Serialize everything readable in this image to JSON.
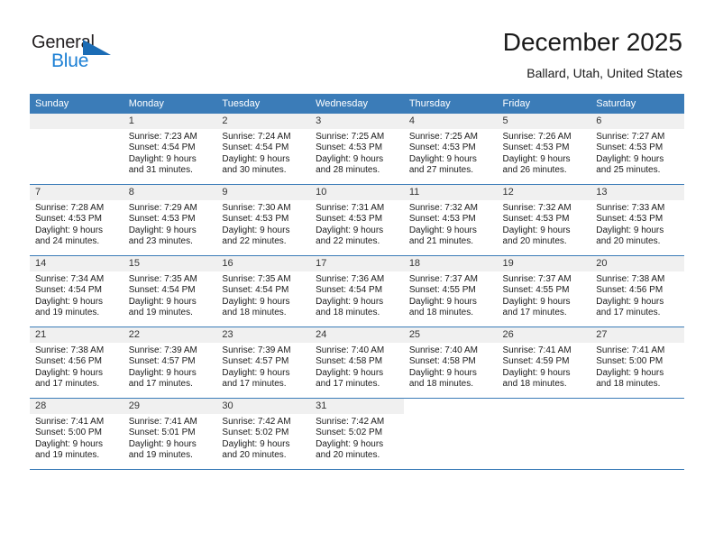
{
  "logo": {
    "word_top": "General",
    "word_bottom": "Blue",
    "triangle_color": "#1b6cb5",
    "blue_color": "#1b7fd4"
  },
  "header": {
    "month_title": "December 2025",
    "location": "Ballard, Utah, United States"
  },
  "theme": {
    "header_row_color": "#3b7cb8",
    "daynum_band_color": "#f0f0f0",
    "grid_line_color": "#3b7cb8"
  },
  "weekday_headers": [
    "Sunday",
    "Monday",
    "Tuesday",
    "Wednesday",
    "Thursday",
    "Friday",
    "Saturday"
  ],
  "weeks": [
    [
      {
        "day": "",
        "lines": []
      },
      {
        "day": "1",
        "lines": [
          "Sunrise: 7:23 AM",
          "Sunset: 4:54 PM",
          "Daylight: 9 hours",
          "and 31 minutes."
        ]
      },
      {
        "day": "2",
        "lines": [
          "Sunrise: 7:24 AM",
          "Sunset: 4:54 PM",
          "Daylight: 9 hours",
          "and 30 minutes."
        ]
      },
      {
        "day": "3",
        "lines": [
          "Sunrise: 7:25 AM",
          "Sunset: 4:53 PM",
          "Daylight: 9 hours",
          "and 28 minutes."
        ]
      },
      {
        "day": "4",
        "lines": [
          "Sunrise: 7:25 AM",
          "Sunset: 4:53 PM",
          "Daylight: 9 hours",
          "and 27 minutes."
        ]
      },
      {
        "day": "5",
        "lines": [
          "Sunrise: 7:26 AM",
          "Sunset: 4:53 PM",
          "Daylight: 9 hours",
          "and 26 minutes."
        ]
      },
      {
        "day": "6",
        "lines": [
          "Sunrise: 7:27 AM",
          "Sunset: 4:53 PM",
          "Daylight: 9 hours",
          "and 25 minutes."
        ]
      }
    ],
    [
      {
        "day": "7",
        "lines": [
          "Sunrise: 7:28 AM",
          "Sunset: 4:53 PM",
          "Daylight: 9 hours",
          "and 24 minutes."
        ]
      },
      {
        "day": "8",
        "lines": [
          "Sunrise: 7:29 AM",
          "Sunset: 4:53 PM",
          "Daylight: 9 hours",
          "and 23 minutes."
        ]
      },
      {
        "day": "9",
        "lines": [
          "Sunrise: 7:30 AM",
          "Sunset: 4:53 PM",
          "Daylight: 9 hours",
          "and 22 minutes."
        ]
      },
      {
        "day": "10",
        "lines": [
          "Sunrise: 7:31 AM",
          "Sunset: 4:53 PM",
          "Daylight: 9 hours",
          "and 22 minutes."
        ]
      },
      {
        "day": "11",
        "lines": [
          "Sunrise: 7:32 AM",
          "Sunset: 4:53 PM",
          "Daylight: 9 hours",
          "and 21 minutes."
        ]
      },
      {
        "day": "12",
        "lines": [
          "Sunrise: 7:32 AM",
          "Sunset: 4:53 PM",
          "Daylight: 9 hours",
          "and 20 minutes."
        ]
      },
      {
        "day": "13",
        "lines": [
          "Sunrise: 7:33 AM",
          "Sunset: 4:53 PM",
          "Daylight: 9 hours",
          "and 20 minutes."
        ]
      }
    ],
    [
      {
        "day": "14",
        "lines": [
          "Sunrise: 7:34 AM",
          "Sunset: 4:54 PM",
          "Daylight: 9 hours",
          "and 19 minutes."
        ]
      },
      {
        "day": "15",
        "lines": [
          "Sunrise: 7:35 AM",
          "Sunset: 4:54 PM",
          "Daylight: 9 hours",
          "and 19 minutes."
        ]
      },
      {
        "day": "16",
        "lines": [
          "Sunrise: 7:35 AM",
          "Sunset: 4:54 PM",
          "Daylight: 9 hours",
          "and 18 minutes."
        ]
      },
      {
        "day": "17",
        "lines": [
          "Sunrise: 7:36 AM",
          "Sunset: 4:54 PM",
          "Daylight: 9 hours",
          "and 18 minutes."
        ]
      },
      {
        "day": "18",
        "lines": [
          "Sunrise: 7:37 AM",
          "Sunset: 4:55 PM",
          "Daylight: 9 hours",
          "and 18 minutes."
        ]
      },
      {
        "day": "19",
        "lines": [
          "Sunrise: 7:37 AM",
          "Sunset: 4:55 PM",
          "Daylight: 9 hours",
          "and 17 minutes."
        ]
      },
      {
        "day": "20",
        "lines": [
          "Sunrise: 7:38 AM",
          "Sunset: 4:56 PM",
          "Daylight: 9 hours",
          "and 17 minutes."
        ]
      }
    ],
    [
      {
        "day": "21",
        "lines": [
          "Sunrise: 7:38 AM",
          "Sunset: 4:56 PM",
          "Daylight: 9 hours",
          "and 17 minutes."
        ]
      },
      {
        "day": "22",
        "lines": [
          "Sunrise: 7:39 AM",
          "Sunset: 4:57 PM",
          "Daylight: 9 hours",
          "and 17 minutes."
        ]
      },
      {
        "day": "23",
        "lines": [
          "Sunrise: 7:39 AM",
          "Sunset: 4:57 PM",
          "Daylight: 9 hours",
          "and 17 minutes."
        ]
      },
      {
        "day": "24",
        "lines": [
          "Sunrise: 7:40 AM",
          "Sunset: 4:58 PM",
          "Daylight: 9 hours",
          "and 17 minutes."
        ]
      },
      {
        "day": "25",
        "lines": [
          "Sunrise: 7:40 AM",
          "Sunset: 4:58 PM",
          "Daylight: 9 hours",
          "and 18 minutes."
        ]
      },
      {
        "day": "26",
        "lines": [
          "Sunrise: 7:41 AM",
          "Sunset: 4:59 PM",
          "Daylight: 9 hours",
          "and 18 minutes."
        ]
      },
      {
        "day": "27",
        "lines": [
          "Sunrise: 7:41 AM",
          "Sunset: 5:00 PM",
          "Daylight: 9 hours",
          "and 18 minutes."
        ]
      }
    ],
    [
      {
        "day": "28",
        "lines": [
          "Sunrise: 7:41 AM",
          "Sunset: 5:00 PM",
          "Daylight: 9 hours",
          "and 19 minutes."
        ]
      },
      {
        "day": "29",
        "lines": [
          "Sunrise: 7:41 AM",
          "Sunset: 5:01 PM",
          "Daylight: 9 hours",
          "and 19 minutes."
        ]
      },
      {
        "day": "30",
        "lines": [
          "Sunrise: 7:42 AM",
          "Sunset: 5:02 PM",
          "Daylight: 9 hours",
          "and 20 minutes."
        ]
      },
      {
        "day": "31",
        "lines": [
          "Sunrise: 7:42 AM",
          "Sunset: 5:02 PM",
          "Daylight: 9 hours",
          "and 20 minutes."
        ]
      },
      {
        "day": "",
        "lines": []
      },
      {
        "day": "",
        "lines": []
      },
      {
        "day": "",
        "lines": []
      }
    ]
  ]
}
